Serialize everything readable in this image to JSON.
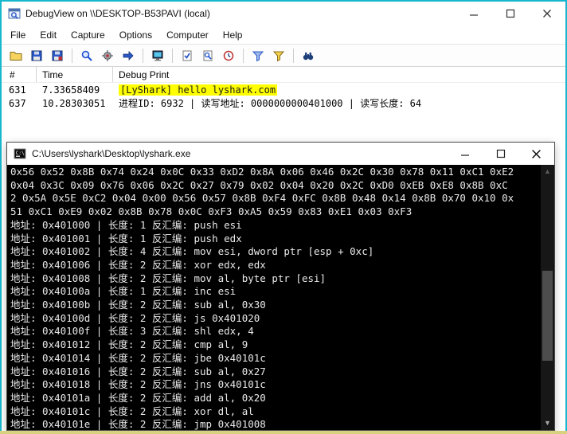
{
  "colors": {
    "window_border": "#17b8ce",
    "highlight_bg": "#ffff00",
    "console_bg": "#000000",
    "console_text": "#e9e9e9",
    "bottom_strip": "#d8d280"
  },
  "debugview": {
    "title": "DebugView on \\\\DESKTOP-B53PAVI (local)",
    "menu": [
      "File",
      "Edit",
      "Capture",
      "Options",
      "Computer",
      "Help"
    ],
    "toolbar_icons": [
      "open-folder",
      "save-floppy",
      "log-to-file-floppy",
      "capture-win32-magnifier",
      "capture-kernel-gear",
      "passthrough-arrow",
      "capture-events-monitor",
      "autoscroll-clipboard-check",
      "history-depth-document-magnifier",
      "clock-time",
      "filter-highlight-funnel",
      "filter-funnel",
      "find-binoculars"
    ],
    "columns": [
      "#",
      "Time",
      "Debug Print"
    ],
    "rows": [
      {
        "num": "631",
        "time": "7.33658409",
        "message": "[LyShark] hello lyshark.com"
      },
      {
        "num": "637",
        "time": "10.28303051",
        "message": "进程ID: 6932  |  读写地址: 0000000000401000  |  读写长度: 64"
      }
    ]
  },
  "console": {
    "title": "C:\\Users\\lyshark\\Desktop\\lyshark.exe",
    "lines": [
      "0x56 0x52 0x8B 0x74 0x24 0x0C 0x33 0xD2 0x8A 0x06 0x46 0x2C 0x30 0x78 0x11 0xC1 0xE2",
      "0x04 0x3C 0x09 0x76 0x06 0x2C 0x27 0x79 0x02 0x04 0x20 0x2C 0xD0 0xEB 0xE8 0x8B 0xC",
      "2 0x5A 0x5E 0xC2 0x04 0x00 0x56 0x57 0x8B 0xF4 0xFC 0x8B 0x48 0x14 0x8B 0x70 0x10 0x",
      "51 0xC1 0xE9 0x02 0x8B 0x78 0x0C 0xF3 0xA5 0x59 0x83 0xE1 0x03 0xF3",
      "地址: 0x401000 | 长度: 1 反汇编: push esi",
      "地址: 0x401001 | 长度: 1 反汇编: push edx",
      "地址: 0x401002 | 长度: 4 反汇编: mov esi, dword ptr [esp + 0xc]",
      "地址: 0x401006 | 长度: 2 反汇编: xor edx, edx",
      "地址: 0x401008 | 长度: 2 反汇编: mov al, byte ptr [esi]",
      "地址: 0x40100a | 长度: 1 反汇编: inc esi",
      "地址: 0x40100b | 长度: 2 反汇编: sub al, 0x30",
      "地址: 0x40100d | 长度: 2 反汇编: js 0x401020",
      "地址: 0x40100f | 长度: 3 反汇编: shl edx, 4",
      "地址: 0x401012 | 长度: 2 反汇编: cmp al, 9",
      "地址: 0x401014 | 长度: 2 反汇编: jbe 0x40101c",
      "地址: 0x401016 | 长度: 2 反汇编: sub al, 0x27",
      "地址: 0x401018 | 长度: 2 反汇编: jns 0x40101c",
      "地址: 0x40101a | 长度: 2 反汇编: add al, 0x20",
      "地址: 0x40101c | 长度: 2 反汇编: xor dl, al",
      "地址: 0x40101e | 长度: 2 反汇编: jmp 0x401008"
    ]
  }
}
